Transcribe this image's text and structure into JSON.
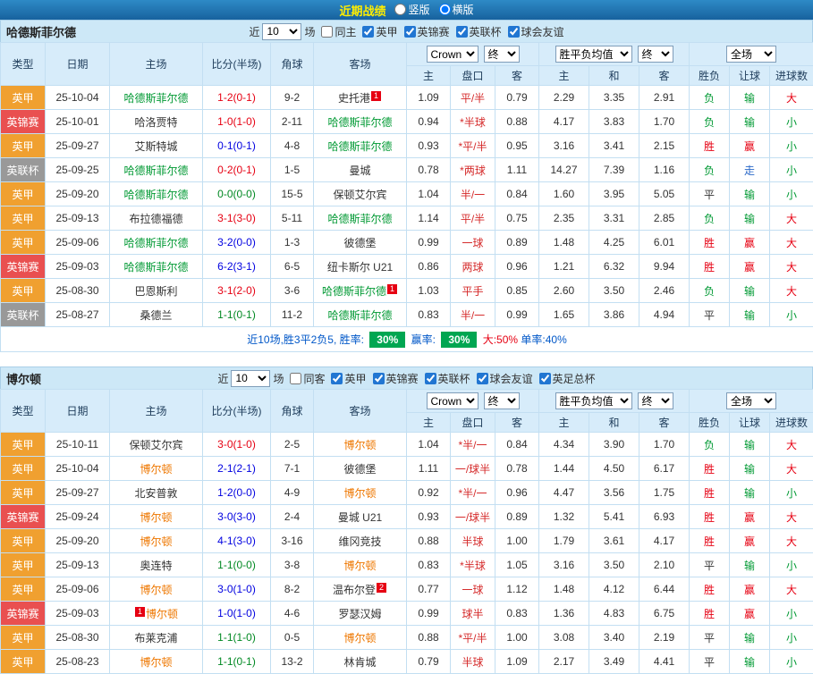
{
  "top_bar": {
    "title": "近期战绩",
    "radios": [
      {
        "label": "竖版",
        "selected": false
      },
      {
        "label": "横版",
        "selected": true
      }
    ]
  },
  "table_head": {
    "cols": [
      "类型",
      "日期",
      "主场",
      "比分(半场)",
      "角球",
      "客场"
    ],
    "sub_cols": [
      "主",
      "盘口",
      "客",
      "主",
      "和",
      "客",
      "胜负",
      "让球",
      "进球数"
    ]
  },
  "colors": {
    "topbar_bg": "#1e6fa8",
    "title_text": "#ffee00",
    "league": {
      "英甲": "#f0a030",
      "英锦赛": "#e95050",
      "英联杯": "#999999"
    },
    "score": {
      "win": "#0000e0",
      "loss": "#e60012",
      "draw": "#008822"
    },
    "result": {
      "win": "#e60012",
      "lose": "#009933",
      "draw": "#333333",
      "push": "#2a68c8"
    },
    "handicap_line": "#d52b2b",
    "summary_green": "#00a651",
    "summary_red": "#e60012",
    "summary_blue": "#0057c8"
  },
  "sections": [
    {
      "team": "哈德斯菲尔德",
      "focal_color": "#009933",
      "near_label": "近",
      "count": "10",
      "games_label": "场",
      "checkboxes": [
        {
          "label": "同主",
          "checked": false
        },
        {
          "label": "英甲",
          "checked": true
        },
        {
          "label": "英锦赛",
          "checked": true
        },
        {
          "label": "英联杯",
          "checked": true
        },
        {
          "label": "球会友谊",
          "checked": true
        }
      ],
      "selects": {
        "company": "Crown",
        "company_time": "终",
        "europe": "胜平负均值",
        "europe_time": "终",
        "scope": "全场"
      },
      "rows": [
        {
          "league": "英甲",
          "date": "25-10-04",
          "home": "哈德斯菲尔德",
          "home_focal": true,
          "score": "1-2(0-1)",
          "res": "loss",
          "corner": "9-2",
          "away": "史托港",
          "away_badge": "1",
          "o1": "1.09",
          "line": "平/半",
          "o2": "0.79",
          "e1": "2.29",
          "e2": "3.35",
          "e3": "2.91",
          "wdl": [
            "负",
            "lose"
          ],
          "ah": [
            "输",
            "lose"
          ],
          "tg": [
            "大",
            "win"
          ]
        },
        {
          "league": "英锦赛",
          "date": "25-10-01",
          "home": "哈洛贾特",
          "score": "1-0(1-0)",
          "res": "loss",
          "corner": "2-11",
          "away": "哈德斯菲尔德",
          "away_focal": true,
          "o1": "0.94",
          "line": "*半球",
          "o2": "0.88",
          "e1": "4.17",
          "e2": "3.83",
          "e3": "1.70",
          "wdl": [
            "负",
            "lose"
          ],
          "ah": [
            "输",
            "lose"
          ],
          "tg": [
            "小",
            "lose"
          ]
        },
        {
          "league": "英甲",
          "date": "25-09-27",
          "home": "艾斯特城",
          "score": "0-1(0-1)",
          "res": "win",
          "corner": "4-8",
          "away": "哈德斯菲尔德",
          "away_focal": true,
          "o1": "0.93",
          "line": "*平/半",
          "o2": "0.95",
          "e1": "3.16",
          "e2": "3.41",
          "e3": "2.15",
          "wdl": [
            "胜",
            "win"
          ],
          "ah": [
            "赢",
            "win"
          ],
          "tg": [
            "小",
            "lose"
          ]
        },
        {
          "league": "英联杯",
          "date": "25-09-25",
          "home": "哈德斯菲尔德",
          "home_focal": true,
          "score": "0-2(0-1)",
          "res": "loss",
          "corner": "1-5",
          "away": "曼城",
          "o1": "0.78",
          "line": "*两球",
          "o2": "1.11",
          "e1": "14.27",
          "e2": "7.39",
          "e3": "1.16",
          "wdl": [
            "负",
            "lose"
          ],
          "ah": [
            "走",
            "push"
          ],
          "tg": [
            "小",
            "lose"
          ]
        },
        {
          "league": "英甲",
          "date": "25-09-20",
          "home": "哈德斯菲尔德",
          "home_focal": true,
          "score": "0-0(0-0)",
          "res": "draw",
          "corner": "15-5",
          "away": "保顿艾尔宾",
          "o1": "1.04",
          "line": "半/一",
          "o2": "0.84",
          "e1": "1.60",
          "e2": "3.95",
          "e3": "5.05",
          "wdl": [
            "平",
            "draw"
          ],
          "ah": [
            "输",
            "lose"
          ],
          "tg": [
            "小",
            "lose"
          ]
        },
        {
          "league": "英甲",
          "date": "25-09-13",
          "home": "布拉德福德",
          "score": "3-1(3-0)",
          "res": "loss",
          "corner": "5-11",
          "away": "哈德斯菲尔德",
          "away_focal": true,
          "o1": "1.14",
          "line": "平/半",
          "o2": "0.75",
          "e1": "2.35",
          "e2": "3.31",
          "e3": "2.85",
          "wdl": [
            "负",
            "lose"
          ],
          "ah": [
            "输",
            "lose"
          ],
          "tg": [
            "大",
            "win"
          ]
        },
        {
          "league": "英甲",
          "date": "25-09-06",
          "home": "哈德斯菲尔德",
          "home_focal": true,
          "score": "3-2(0-0)",
          "res": "win",
          "corner": "1-3",
          "away": "彼德堡",
          "o1": "0.99",
          "line": "一球",
          "o2": "0.89",
          "e1": "1.48",
          "e2": "4.25",
          "e3": "6.01",
          "wdl": [
            "胜",
            "win"
          ],
          "ah": [
            "赢",
            "win"
          ],
          "tg": [
            "大",
            "win"
          ]
        },
        {
          "league": "英锦赛",
          "date": "25-09-03",
          "home": "哈德斯菲尔德",
          "home_focal": true,
          "score": "6-2(3-1)",
          "res": "win",
          "corner": "6-5",
          "away": "纽卡斯尔 U21",
          "o1": "0.86",
          "line": "两球",
          "o2": "0.96",
          "e1": "1.21",
          "e2": "6.32",
          "e3": "9.94",
          "wdl": [
            "胜",
            "win"
          ],
          "ah": [
            "赢",
            "win"
          ],
          "tg": [
            "大",
            "win"
          ]
        },
        {
          "league": "英甲",
          "date": "25-08-30",
          "home": "巴恩斯利",
          "score": "3-1(2-0)",
          "res": "loss",
          "corner": "3-6",
          "away": "哈德斯菲尔德",
          "away_focal": true,
          "away_badge": "1",
          "o1": "1.03",
          "line": "平手",
          "o2": "0.85",
          "e1": "2.60",
          "e2": "3.50",
          "e3": "2.46",
          "wdl": [
            "负",
            "lose"
          ],
          "ah": [
            "输",
            "lose"
          ],
          "tg": [
            "大",
            "win"
          ]
        },
        {
          "league": "英联杯",
          "date": "25-08-27",
          "home": "桑德兰",
          "score": "1-1(0-1)",
          "res": "draw",
          "corner": "11-2",
          "away": "哈德斯菲尔德",
          "away_focal": true,
          "o1": "0.83",
          "line": "半/一",
          "o2": "0.99",
          "e1": "1.65",
          "e2": "3.86",
          "e3": "4.94",
          "wdl": [
            "平",
            "draw"
          ],
          "ah": [
            "输",
            "lose"
          ],
          "tg": [
            "小",
            "lose"
          ]
        }
      ],
      "summary": [
        {
          "text": "近10场,胜3平2负5, 胜率: ",
          "type": "blue"
        },
        {
          "text": "30%",
          "type": "badge"
        },
        {
          "text": " 赢率: ",
          "type": "blue"
        },
        {
          "text": "30%",
          "type": "badge"
        },
        {
          "text": " 大:50%",
          "type": "red"
        },
        {
          "text": " 单率:40%",
          "type": "blue"
        }
      ]
    },
    {
      "team": "博尔顿",
      "focal_color": "#ee7700",
      "near_label": "近",
      "count": "10",
      "games_label": "场",
      "checkboxes": [
        {
          "label": "同客",
          "checked": false
        },
        {
          "label": "英甲",
          "checked": true
        },
        {
          "label": "英锦赛",
          "checked": true
        },
        {
          "label": "英联杯",
          "checked": true
        },
        {
          "label": "球会友谊",
          "checked": true
        },
        {
          "label": "英足总杯",
          "checked": true
        }
      ],
      "selects": {
        "company": "Crown",
        "company_time": "终",
        "europe": "胜平负均值",
        "europe_time": "终",
        "scope": "全场"
      },
      "rows": [
        {
          "league": "英甲",
          "date": "25-10-11",
          "home": "保顿艾尔宾",
          "score": "3-0(1-0)",
          "res": "loss",
          "corner": "2-5",
          "away": "博尔顿",
          "away_focal": true,
          "o1": "1.04",
          "line": "*半/一",
          "o2": "0.84",
          "e1": "4.34",
          "e2": "3.90",
          "e3": "1.70",
          "wdl": [
            "负",
            "lose"
          ],
          "ah": [
            "输",
            "lose"
          ],
          "tg": [
            "大",
            "win"
          ]
        },
        {
          "league": "英甲",
          "date": "25-10-04",
          "home": "博尔顿",
          "home_focal": true,
          "score": "2-1(2-1)",
          "res": "win",
          "corner": "7-1",
          "away": "彼德堡",
          "o1": "1.11",
          "line": "一/球半",
          "o2": "0.78",
          "e1": "1.44",
          "e2": "4.50",
          "e3": "6.17",
          "wdl": [
            "胜",
            "win"
          ],
          "ah": [
            "输",
            "lose"
          ],
          "tg": [
            "大",
            "win"
          ]
        },
        {
          "league": "英甲",
          "date": "25-09-27",
          "home": "北安普敦",
          "score": "1-2(0-0)",
          "res": "win",
          "corner": "4-9",
          "away": "博尔顿",
          "away_focal": true,
          "o1": "0.92",
          "line": "*半/一",
          "o2": "0.96",
          "e1": "4.47",
          "e2": "3.56",
          "e3": "1.75",
          "wdl": [
            "胜",
            "win"
          ],
          "ah": [
            "输",
            "lose"
          ],
          "tg": [
            "小",
            "lose"
          ]
        },
        {
          "league": "英锦赛",
          "date": "25-09-24",
          "home": "博尔顿",
          "home_focal": true,
          "score": "3-0(3-0)",
          "res": "win",
          "corner": "2-4",
          "away": "曼城 U21",
          "o1": "0.93",
          "line": "一/球半",
          "o2": "0.89",
          "e1": "1.32",
          "e2": "5.41",
          "e3": "6.93",
          "wdl": [
            "胜",
            "win"
          ],
          "ah": [
            "赢",
            "win"
          ],
          "tg": [
            "大",
            "win"
          ]
        },
        {
          "league": "英甲",
          "date": "25-09-20",
          "home": "博尔顿",
          "home_focal": true,
          "score": "4-1(3-0)",
          "res": "win",
          "corner": "3-16",
          "away": "维冈竞技",
          "o1": "0.88",
          "line": "半球",
          "o2": "1.00",
          "e1": "1.79",
          "e2": "3.61",
          "e3": "4.17",
          "wdl": [
            "胜",
            "win"
          ],
          "ah": [
            "赢",
            "win"
          ],
          "tg": [
            "大",
            "win"
          ]
        },
        {
          "league": "英甲",
          "date": "25-09-13",
          "home": "奥连特",
          "score": "1-1(0-0)",
          "res": "draw",
          "corner": "3-8",
          "away": "博尔顿",
          "away_focal": true,
          "o1": "0.83",
          "line": "*半球",
          "o2": "1.05",
          "e1": "3.16",
          "e2": "3.50",
          "e3": "2.10",
          "wdl": [
            "平",
            "draw"
          ],
          "ah": [
            "输",
            "lose"
          ],
          "tg": [
            "小",
            "lose"
          ]
        },
        {
          "league": "英甲",
          "date": "25-09-06",
          "home": "博尔顿",
          "home_focal": true,
          "score": "3-0(1-0)",
          "res": "win",
          "corner": "8-2",
          "away": "温布尔登",
          "away_badge": "2",
          "o1": "0.77",
          "line": "一球",
          "o2": "1.12",
          "e1": "1.48",
          "e2": "4.12",
          "e3": "6.44",
          "wdl": [
            "胜",
            "win"
          ],
          "ah": [
            "赢",
            "win"
          ],
          "tg": [
            "大",
            "win"
          ]
        },
        {
          "league": "英锦赛",
          "date": "25-09-03",
          "home": "博尔顿",
          "home_focal": true,
          "home_badge": "1",
          "home_badge_before": true,
          "score": "1-0(1-0)",
          "res": "win",
          "corner": "4-6",
          "away": "罗瑟汉姆",
          "o1": "0.99",
          "line": "球半",
          "o2": "0.83",
          "e1": "1.36",
          "e2": "4.83",
          "e3": "6.75",
          "wdl": [
            "胜",
            "win"
          ],
          "ah": [
            "赢",
            "win"
          ],
          "tg": [
            "小",
            "lose"
          ]
        },
        {
          "league": "英甲",
          "date": "25-08-30",
          "home": "布莱克浦",
          "score": "1-1(1-0)",
          "res": "draw",
          "corner": "0-5",
          "away": "博尔顿",
          "away_focal": true,
          "o1": "0.88",
          "line": "*平/半",
          "o2": "1.00",
          "e1": "3.08",
          "e2": "3.40",
          "e3": "2.19",
          "wdl": [
            "平",
            "draw"
          ],
          "ah": [
            "输",
            "lose"
          ],
          "tg": [
            "小",
            "lose"
          ]
        },
        {
          "league": "英甲",
          "date": "25-08-23",
          "home": "博尔顿",
          "home_focal": true,
          "score": "1-1(0-1)",
          "res": "draw",
          "corner": "13-2",
          "away": "林肯城",
          "o1": "0.79",
          "line": "半球",
          "o2": "1.09",
          "e1": "2.17",
          "e2": "3.49",
          "e3": "4.41",
          "wdl": [
            "平",
            "draw"
          ],
          "ah": [
            "输",
            "lose"
          ],
          "tg": [
            "小",
            "lose"
          ]
        }
      ]
    }
  ]
}
